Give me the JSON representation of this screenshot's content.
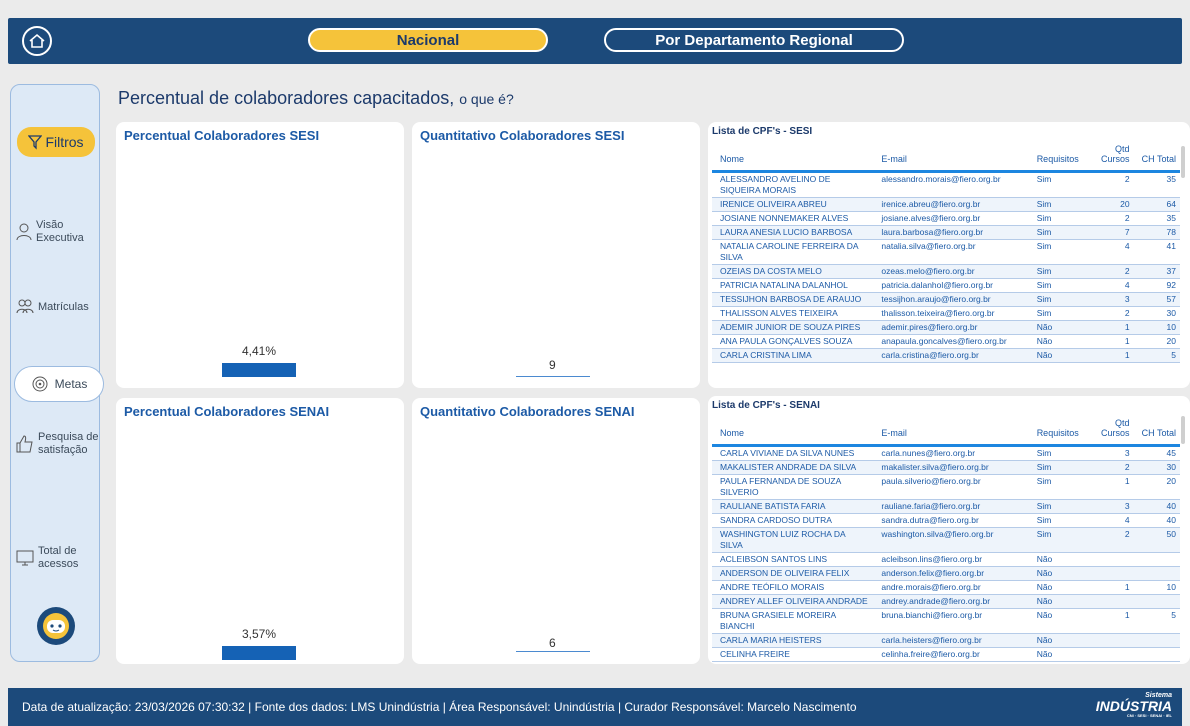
{
  "header": {
    "tab_nacional": "Nacional",
    "tab_regional": "Por Departamento Regional"
  },
  "sidebar": {
    "filtros": "Filtros",
    "visao_executiva": [
      "Visão",
      "Executiva"
    ],
    "matriculas": "Matrículas",
    "metas": "Metas",
    "pesquisa": [
      "Pesquisa de",
      "satisfação"
    ],
    "total_acessos": [
      "Total de",
      "acessos"
    ]
  },
  "page": {
    "title": "Percentual de colaboradores capacitados,",
    "title_sub": "o que é?"
  },
  "cards": {
    "sesi_pct_title": "Percentual Colaboradores SESI",
    "sesi_pct_value": "4,41%",
    "sesi_qtd_title": "Quantitativo Colaboradores SESI",
    "sesi_qtd_value": "9",
    "senai_pct_title": "Percentual Colaboradores SENAI",
    "senai_pct_value": "3,57%",
    "senai_qtd_title": "Quantitativo Colaboradores SENAI",
    "senai_qtd_value": "6"
  },
  "sesi_table": {
    "title": "Lista de CPF's - SESI",
    "columns": [
      "Nome",
      "E-mail",
      "Requisitos",
      "Qtd Cursos",
      "CH Total"
    ],
    "rows": [
      [
        "ALESSANDRO AVELINO DE SIQUEIRA MORAIS",
        "alessandro.morais@fiero.org.br",
        "Sim",
        "2",
        "35"
      ],
      [
        "IRENICE OLIVEIRA ABREU",
        "irenice.abreu@fiero.org.br",
        "Sim",
        "20",
        "64"
      ],
      [
        "JOSIANE NONNEMAKER ALVES",
        "josiane.alves@fiero.org.br",
        "Sim",
        "2",
        "35"
      ],
      [
        "LAURA ANESIA LUCIO BARBOSA",
        "laura.barbosa@fiero.org.br",
        "Sim",
        "7",
        "78"
      ],
      [
        "NATALIA CAROLINE FERREIRA DA SILVA",
        "natalia.silva@fiero.org.br",
        "Sim",
        "4",
        "41"
      ],
      [
        "OZEIAS DA COSTA MELO",
        "ozeas.melo@fiero.org.br",
        "Sim",
        "2",
        "37"
      ],
      [
        "PATRICIA NATALINA DALANHOL",
        "patricia.dalanhol@fiero.org.br",
        "Sim",
        "4",
        "92"
      ],
      [
        "TESSIJHON BARBOSA DE ARAUJO",
        "tessijhon.araujo@fiero.org.br",
        "Sim",
        "3",
        "57"
      ],
      [
        "THALISSON ALVES TEIXEIRA",
        "thalisson.teixeira@fiero.org.br",
        "Sim",
        "2",
        "30"
      ],
      [
        "ADEMIR JUNIOR DE SOUZA PIRES",
        "ademir.pires@fiero.org.br",
        "Não",
        "1",
        "10"
      ],
      [
        "ANA PAULA GONÇALVES SOUZA",
        "anapaula.goncalves@fiero.org.br",
        "Não",
        "1",
        "20"
      ],
      [
        "CARLA CRISTINA LIMA",
        "carla.cristina@fiero.org.br",
        "Não",
        "1",
        "5"
      ]
    ]
  },
  "senai_table": {
    "title": "Lista de CPF's - SENAI",
    "columns": [
      "Nome",
      "E-mail",
      "Requisitos",
      "Qtd Cursos",
      "CH Total"
    ],
    "rows": [
      [
        "CARLA VIVIANE DA SILVA NUNES",
        "carla.nunes@fiero.org.br",
        "Sim",
        "3",
        "45"
      ],
      [
        "MAKALISTER ANDRADE DA SILVA",
        "makalister.silva@fiero.org.br",
        "Sim",
        "2",
        "30"
      ],
      [
        "PAULA FERNANDA DE SOUZA SILVERIO",
        "paula.silverio@fiero.org.br",
        "Sim",
        "1",
        "20"
      ],
      [
        "RAULIANE BATISTA FARIA",
        "rauliane.faria@fiero.org.br",
        "Sim",
        "3",
        "40"
      ],
      [
        "SANDRA CARDOSO DUTRA",
        "sandra.dutra@fiero.org.br",
        "Sim",
        "4",
        "40"
      ],
      [
        "WASHINGTON LUIZ ROCHA DA SILVA",
        "washington.silva@fiero.org.br",
        "Sim",
        "2",
        "50"
      ],
      [
        "ACLEIBSON SANTOS LINS",
        "acleibson.lins@fiero.org.br",
        "Não",
        "",
        ""
      ],
      [
        "ANDERSON DE OLIVEIRA FELIX",
        "anderson.felix@fiero.org.br",
        "Não",
        "",
        ""
      ],
      [
        "ANDRE TEÓFILO MORAIS",
        "andre.morais@fiero.org.br",
        "Não",
        "1",
        "10"
      ],
      [
        "ANDREY ALLEF OLIVEIRA ANDRADE",
        "andrey.andrade@fiero.org.br",
        "Não",
        "",
        ""
      ],
      [
        "BRUNA GRASIELE MOREIRA BIANCHI",
        "bruna.bianchi@fiero.org.br",
        "Não",
        "1",
        "5"
      ],
      [
        "CARLA MARIA HEISTERS",
        "carla.heisters@fiero.org.br",
        "Não",
        "",
        ""
      ],
      [
        "CELINHA FREIRE",
        "celinha.freire@fiero.org.br",
        "Não",
        "",
        ""
      ]
    ]
  },
  "footer": {
    "text": "Data de atualização:  23/03/2026 07:30:32  | Fonte dos dados: LMS Unindústria | Área Responsável: Unindústria | Curador Responsável: Marcelo Nascimento",
    "logo_top": "Sistema",
    "logo_main": "INDÚSTRIA",
    "logo_sub": "CNI · SESI · SENAI · IEL"
  },
  "colors": {
    "header": "#1c4a7b",
    "accent": "#f5c33a",
    "bar": "#1562b5"
  }
}
